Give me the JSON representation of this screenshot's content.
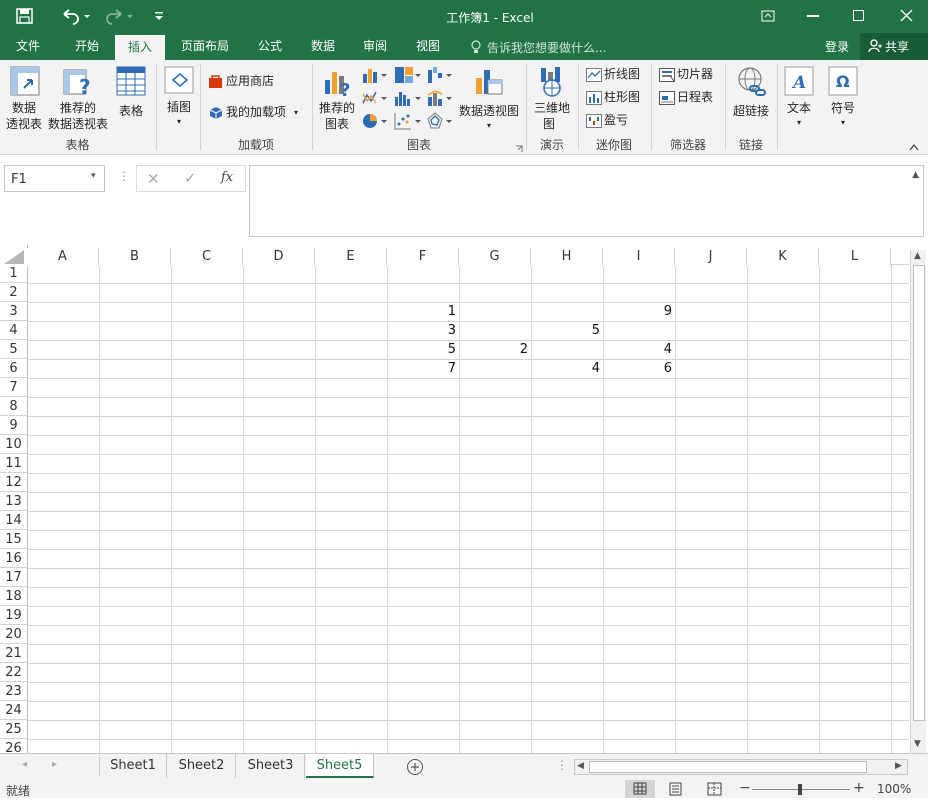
{
  "title_bar": {
    "title": "工作簿1 - Excel"
  },
  "ribbon_tabs": [
    "文件",
    "开始",
    "插入",
    "页面布局",
    "公式",
    "数据",
    "审阅",
    "视图"
  ],
  "active_tab": "插入",
  "tell_me": "告诉我您想要做什么...",
  "login": "登录",
  "share": "共享",
  "ribbon": {
    "pivot_table": [
      "数据",
      "透视表"
    ],
    "recommended_pivot": [
      "推荐的",
      "数据透视表"
    ],
    "table": "表格",
    "illustrations": "插图",
    "app_store": "应用商店",
    "my_addins": "我的加载项",
    "recommended_charts": [
      "推荐的",
      "图表"
    ],
    "pivot_chart": "数据透视图",
    "map_3d": [
      "三维地",
      "图"
    ],
    "sparkline_line": "折线图",
    "sparkline_column": "柱形图",
    "sparkline_winloss": "盈亏",
    "slicer": "切片器",
    "timeline": "日程表",
    "hyperlink": "超链接",
    "text": "文本",
    "symbols": "符号",
    "groups": {
      "tables": "表格",
      "addins": "加载项",
      "charts": "图表",
      "tours": "演示",
      "sparklines": "迷你图",
      "filters": "筛选器",
      "links": "链接"
    }
  },
  "formula_bar": {
    "name_box": "F1",
    "fx": "fx",
    "formula": ""
  },
  "columns": [
    "A",
    "B",
    "C",
    "D",
    "E",
    "F",
    "G",
    "H",
    "I",
    "J",
    "K",
    "L"
  ],
  "rows": [
    "1",
    "2",
    "3",
    "4",
    "5",
    "6",
    "7",
    "8",
    "9",
    "10",
    "11",
    "12",
    "13",
    "14",
    "15",
    "16",
    "17",
    "18",
    "19",
    "20",
    "21",
    "22",
    "23",
    "24",
    "25",
    "26"
  ],
  "cells": [
    {
      "ref": "F3",
      "value": "1"
    },
    {
      "ref": "I3",
      "value": "9"
    },
    {
      "ref": "F4",
      "value": "3"
    },
    {
      "ref": "H4",
      "value": "5"
    },
    {
      "ref": "F5",
      "value": "5"
    },
    {
      "ref": "G5",
      "value": "2"
    },
    {
      "ref": "I5",
      "value": "4"
    },
    {
      "ref": "F6",
      "value": "7"
    },
    {
      "ref": "H6",
      "value": "4"
    },
    {
      "ref": "I6",
      "value": "6"
    }
  ],
  "sheet_tabs": [
    "Sheet1",
    "Sheet2",
    "Sheet3",
    "Sheet5"
  ],
  "active_sheet": "Sheet5",
  "status": {
    "ready": "就绪",
    "zoom": "100%",
    "zoom_level": 1.0
  },
  "colors": {
    "accent": "#217346",
    "ribbon_bg": "#f3f3f3",
    "grid": "#d4d4d4"
  }
}
